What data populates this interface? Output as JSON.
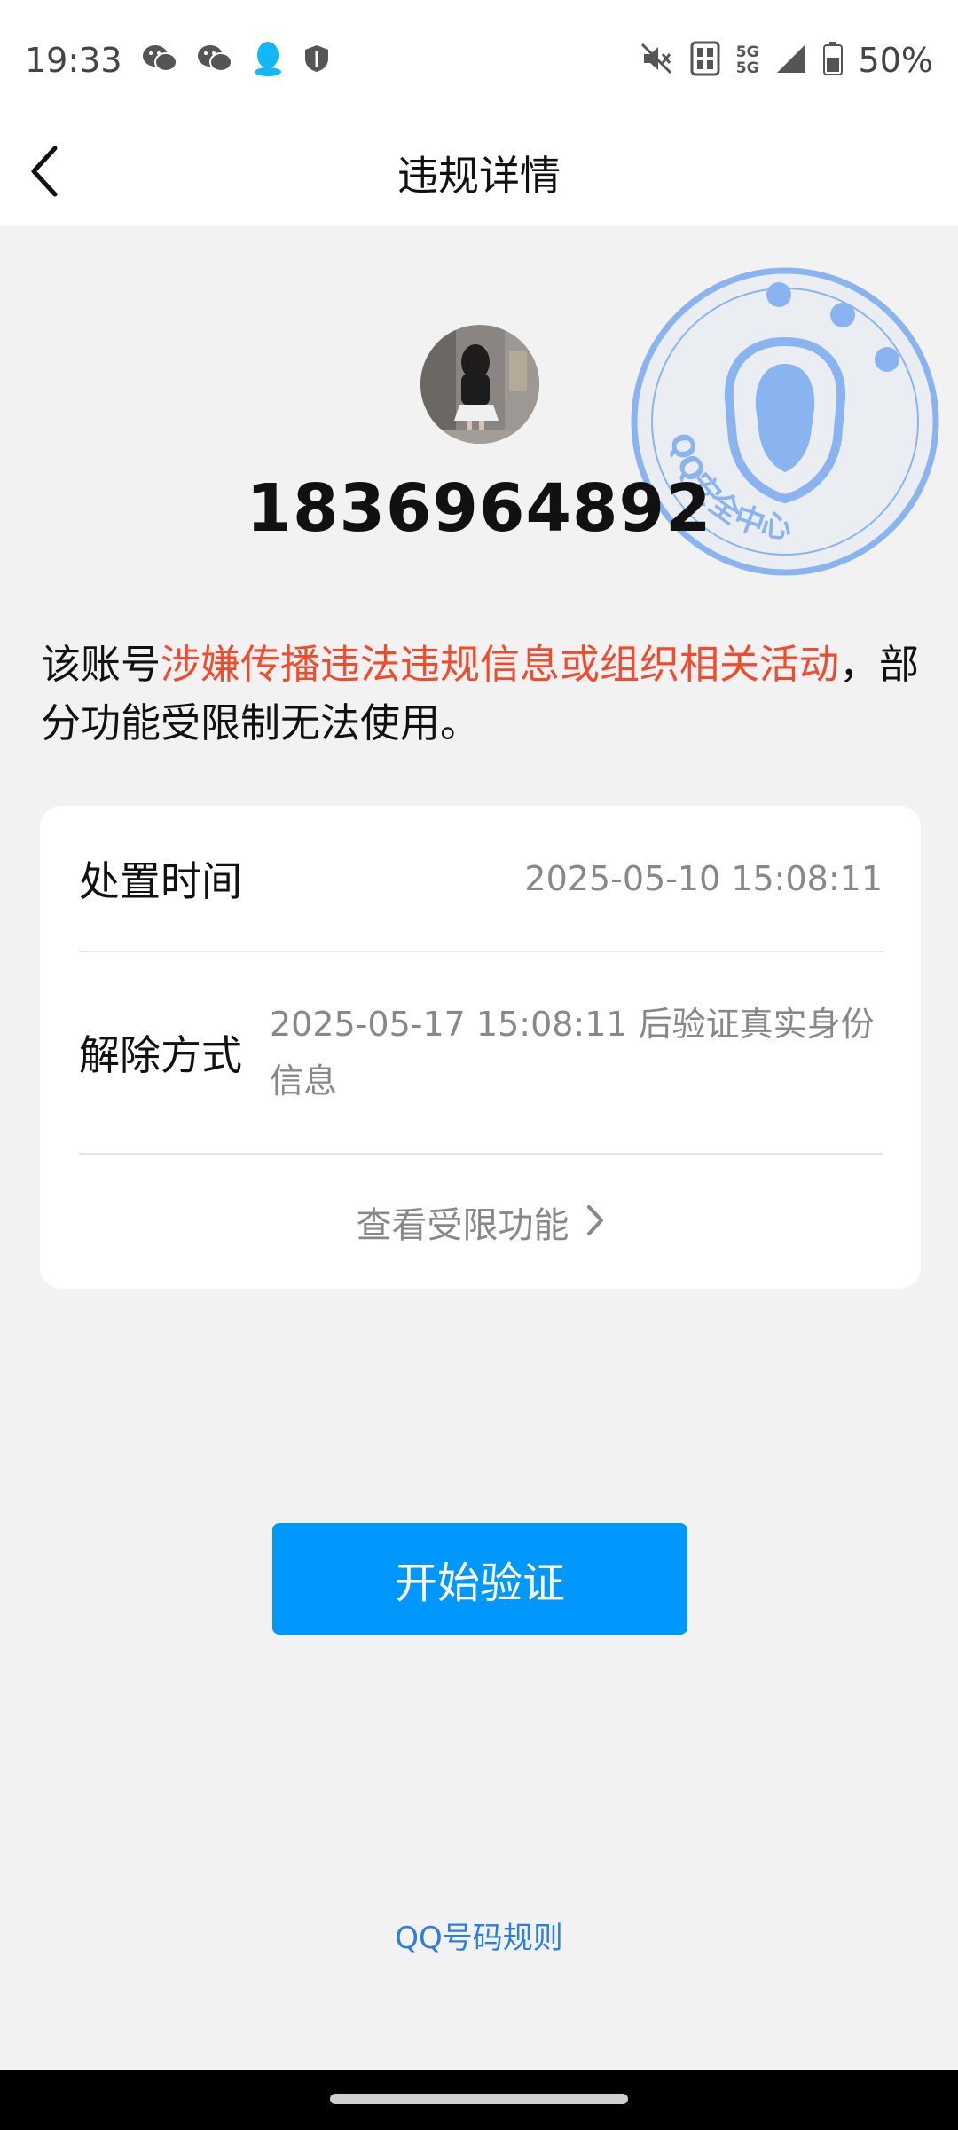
{
  "status_bar": {
    "time": "19:33",
    "battery": "50%",
    "left_icons": [
      "wechat-icon",
      "wechat-icon",
      "qq-icon",
      "shield-icon"
    ],
    "right_icons": [
      "mute-icon",
      "sim-icon",
      "5g-signal-icon",
      "signal-icon",
      "battery-icon"
    ],
    "network_labels": [
      "5G",
      "5G"
    ]
  },
  "header": {
    "title": "违规详情",
    "back_icon": "chevron-left-icon"
  },
  "stamp": {
    "text": "QQ安全中心",
    "color": "#8ab4f0"
  },
  "account": {
    "qq_number": "1836964892"
  },
  "notice": {
    "prefix": "该账号",
    "highlight": "涉嫌传播违法违规信息或组织相关活动",
    "suffix": "，部分功能受限制无法使用。",
    "highlight_color": "#f24a2c"
  },
  "details": {
    "time_label": "处置时间",
    "time_value": "2025-05-10 15:08:11",
    "release_label": "解除方式",
    "release_value": "2025-05-17 15:08:11 后验证真实身份信息",
    "view_limits": "查看受限功能"
  },
  "actions": {
    "start_verify": "开始验证",
    "button_color": "#0098fd"
  },
  "footer": {
    "rules_link": "QQ号码规则"
  }
}
